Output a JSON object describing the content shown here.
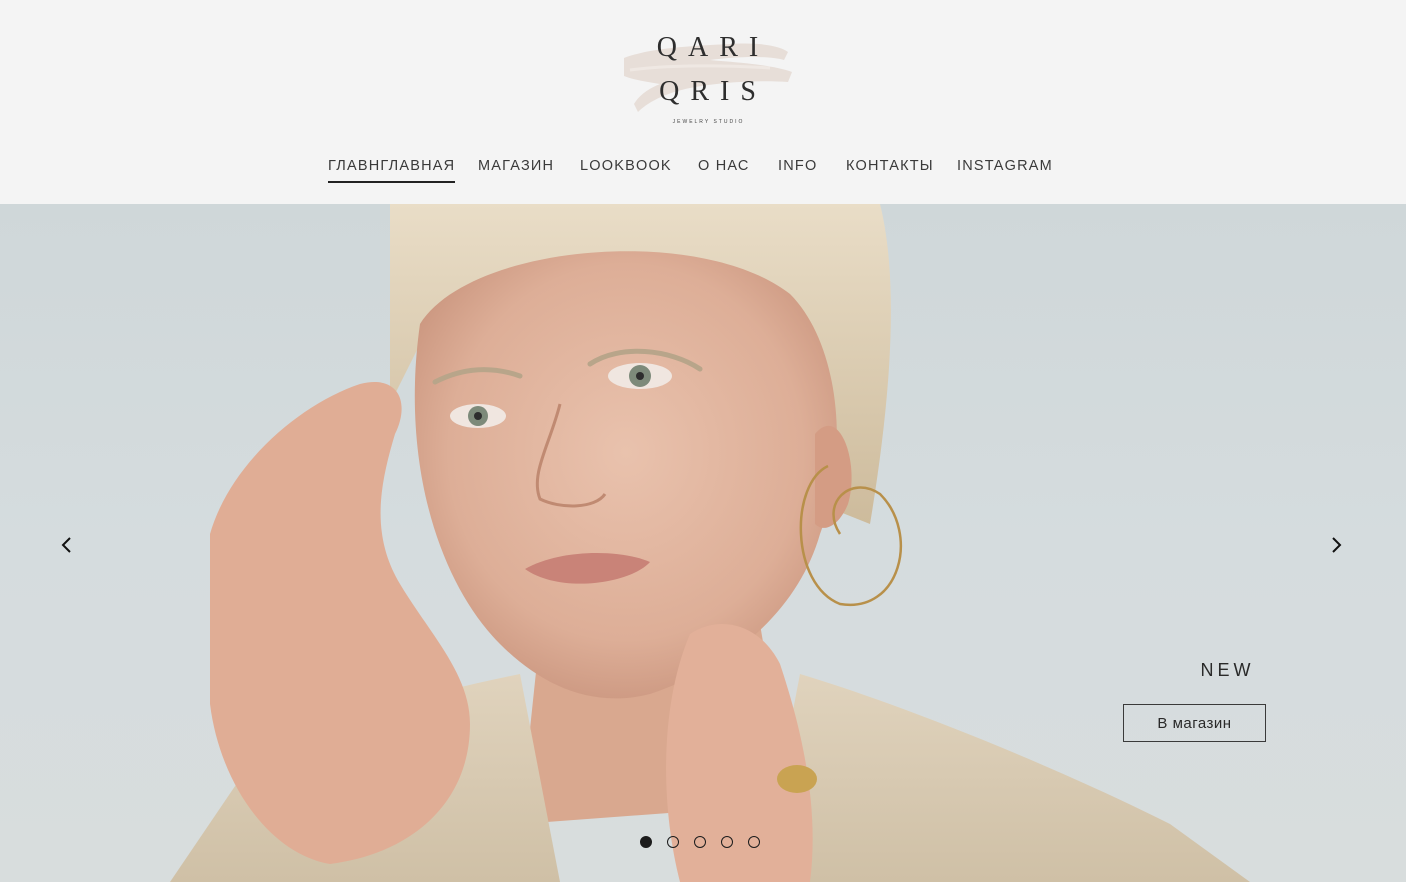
{
  "brand": {
    "line1": "QARI",
    "line2": "QRIS",
    "tagline": "JEWELRY STUDIO"
  },
  "nav": {
    "items": [
      {
        "label": "ГЛАВНГЛАВНАЯ",
        "active": true
      },
      {
        "label": "МАГАЗИН",
        "active": false
      },
      {
        "label": "LOOKBOOK",
        "active": false
      },
      {
        "label": "О НАС",
        "active": false
      },
      {
        "label": "INFO",
        "active": false
      },
      {
        "label": "КОНТАКТЫ",
        "active": false
      },
      {
        "label": "INSTAGRAM",
        "active": false
      }
    ]
  },
  "hero": {
    "label": "NEW",
    "button_label": "В магазин",
    "prev_icon": "chevron-left-icon",
    "next_icon": "chevron-right-icon",
    "slides_total": 5,
    "active_slide": 1
  },
  "colors": {
    "background": "#f4f4f4",
    "brush": "#e6dcd6",
    "text": "#2b2b2b",
    "hero_wall": "#d3dadc"
  }
}
